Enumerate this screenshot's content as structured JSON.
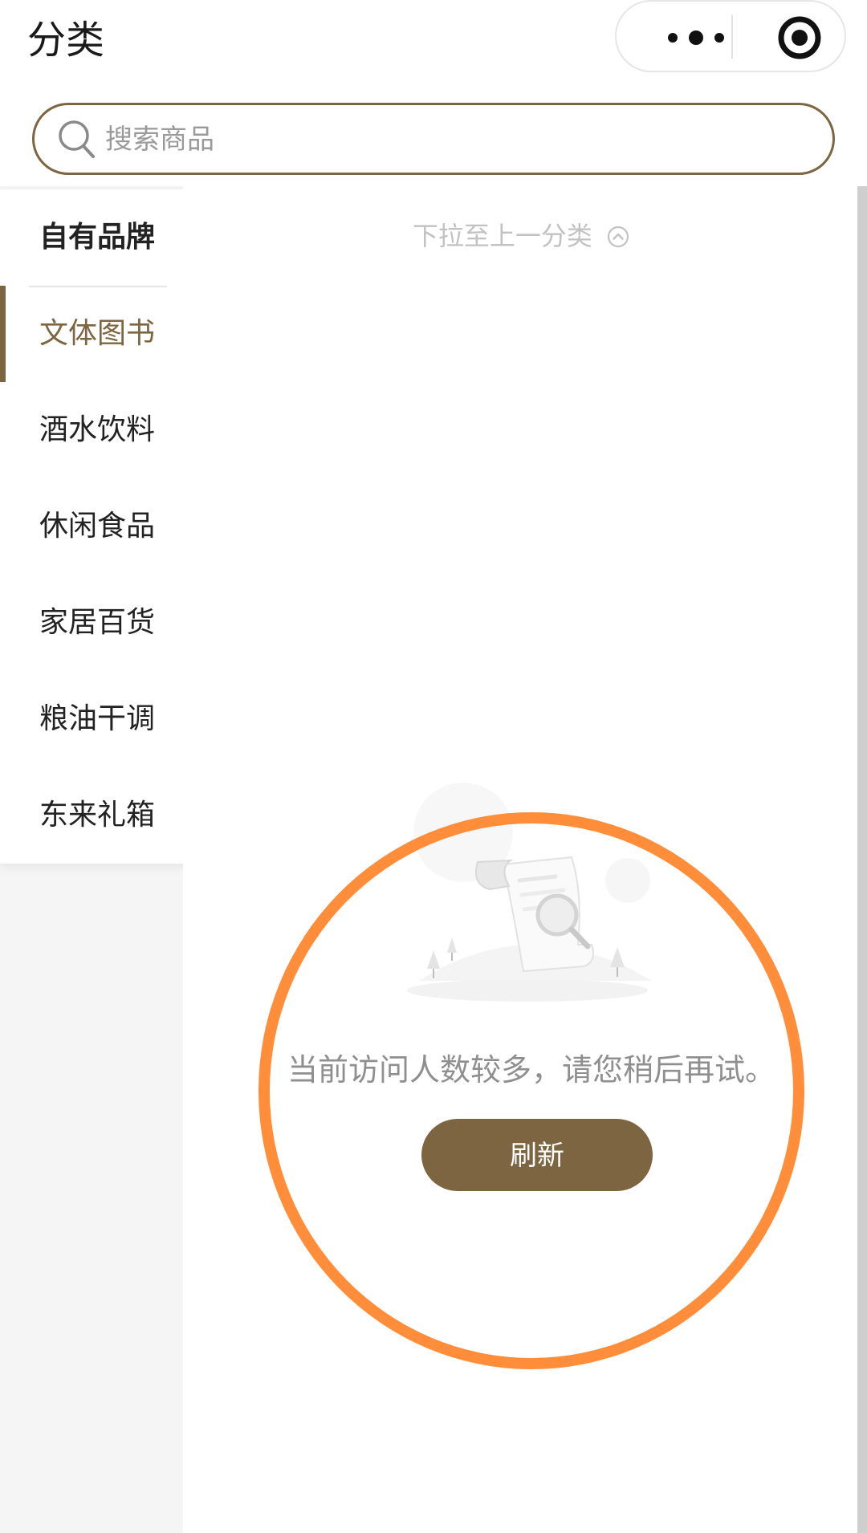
{
  "header": {
    "title": "分类",
    "capsule": {
      "more_icon": "more-dots-icon",
      "close_icon": "target-circle-icon"
    }
  },
  "search": {
    "placeholder": "搜索商品",
    "value": "",
    "icon": "search-icon"
  },
  "sidebar": {
    "items": [
      {
        "label": "自有品牌",
        "bold": true
      },
      {
        "label": "文体图书",
        "active": true
      },
      {
        "label": "酒水饮料"
      },
      {
        "label": "休闲食品"
      },
      {
        "label": "家居百货"
      },
      {
        "label": "粮油干调"
      },
      {
        "label": "东来礼箱"
      }
    ]
  },
  "content": {
    "pull_hint": "下拉至上一分类",
    "pull_hint_icon": "chevron-up-circle-icon",
    "error_message": "当前访问人数较多，请您稍后再试。",
    "refresh_label": "刷新"
  },
  "colors": {
    "accent": "#7c6540",
    "annotation_ring": "#ff8d3a",
    "sidebar_bg": "#f5f5f5"
  }
}
